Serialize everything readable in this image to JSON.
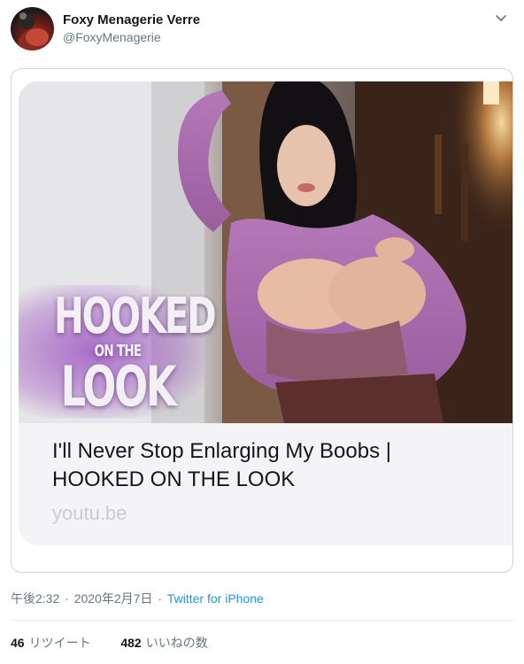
{
  "tweet": {
    "display_name": "Foxy Menagerie Verre",
    "handle": "@FoxyMenagerie",
    "card": {
      "title_line1": "I'll Never Stop Enlarging My Boobs |",
      "title_line2": "HOOKED ON THE LOOK",
      "domain": "youtu.be",
      "thumbnail_text": {
        "line1": "HOOKED",
        "line2": "ON THE",
        "line3": "LOOK"
      }
    },
    "time": "午後2:32",
    "date": "2020年2月7日",
    "separator": "·",
    "client": "Twitter for iPhone",
    "retweets_count": "46",
    "retweets_label": "リツイート",
    "likes_count": "482",
    "likes_label": "いいねの数"
  },
  "colors": {
    "link": "#1b95e0",
    "secondary_text": "#657786",
    "border": "#ccd6dd"
  }
}
